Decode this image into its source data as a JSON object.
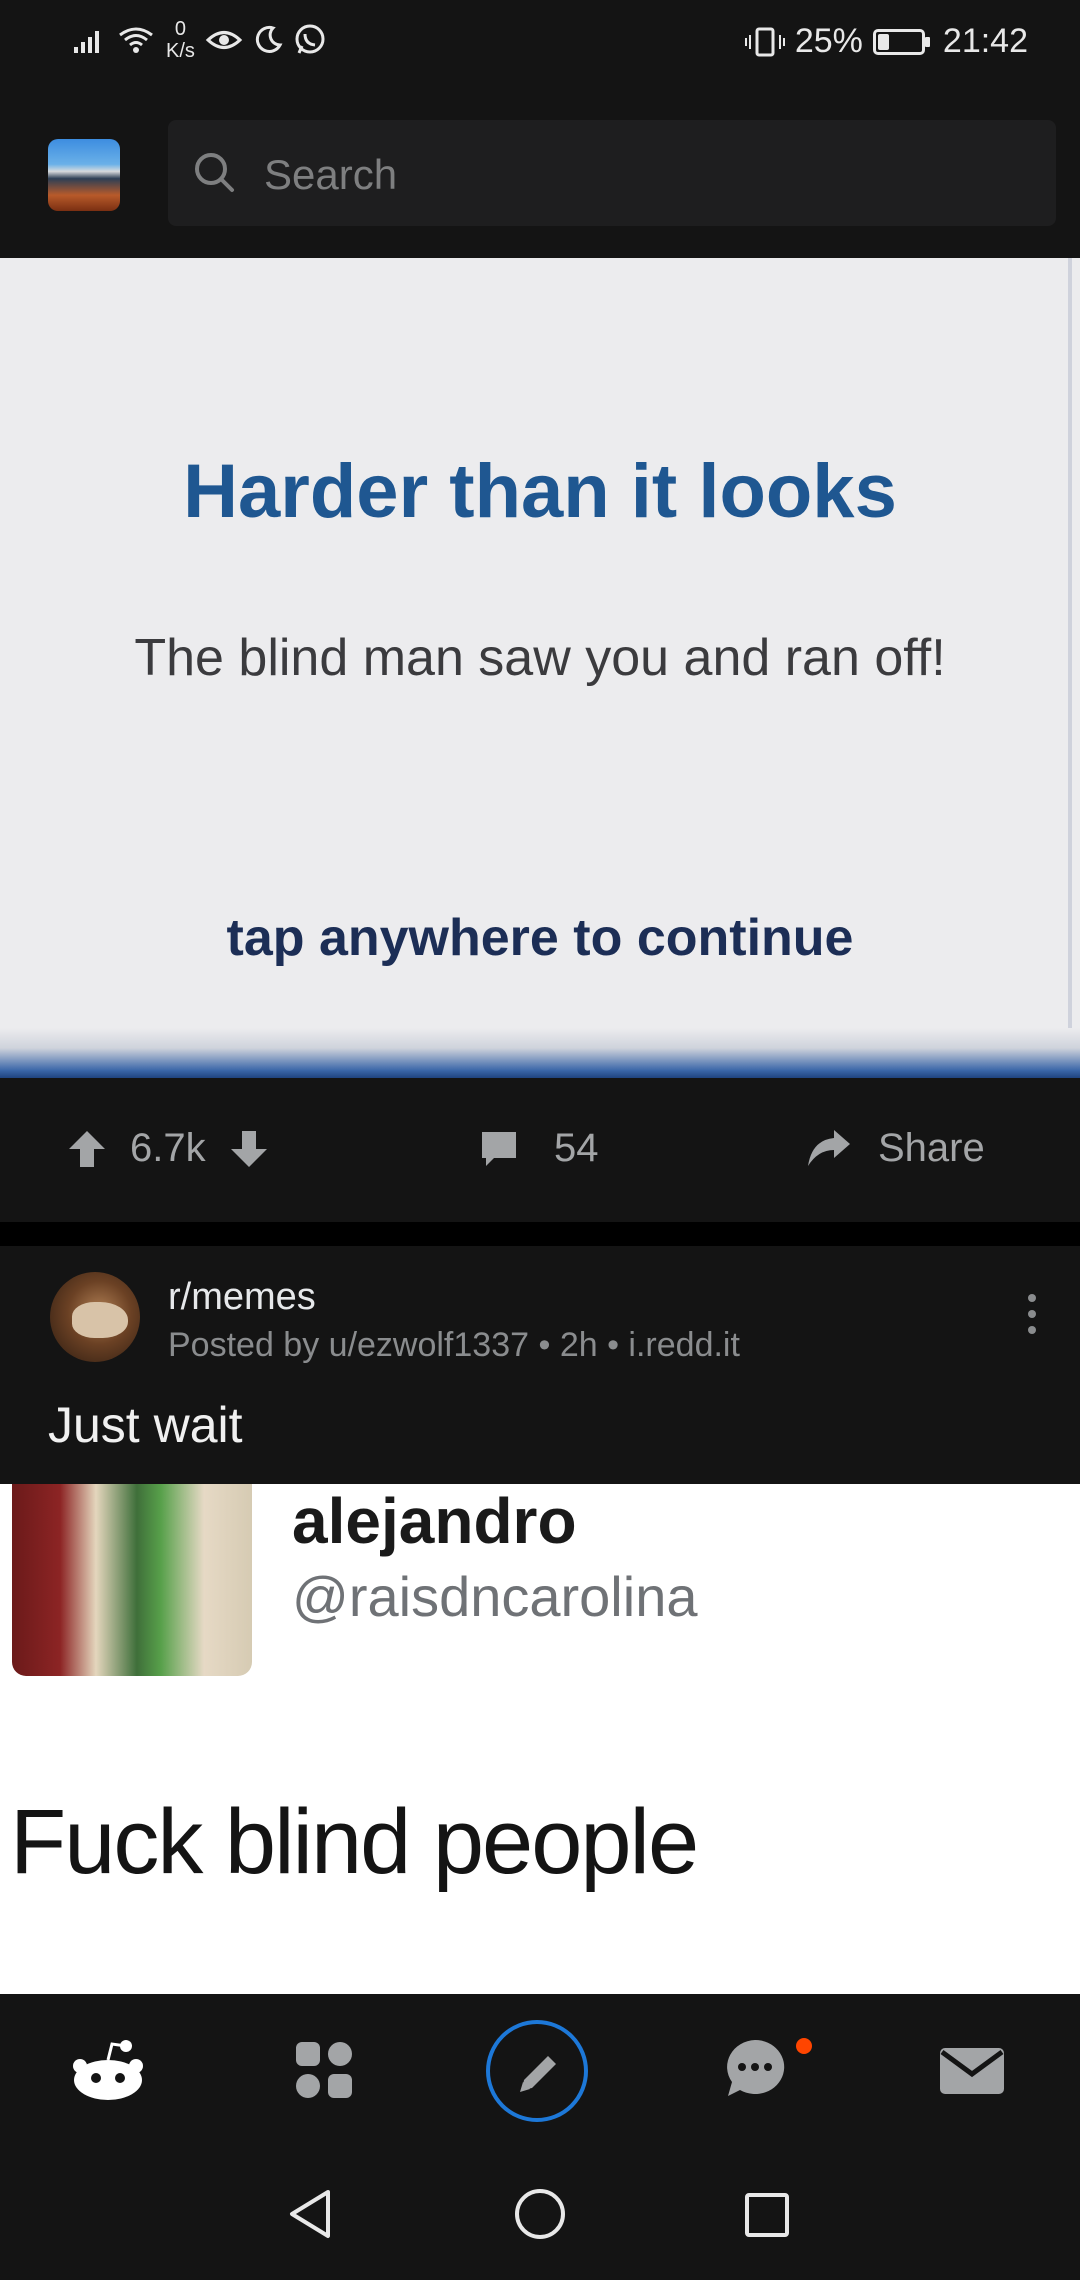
{
  "status_bar": {
    "net_speed_value": "0",
    "net_speed_unit": "K/s",
    "battery_percent": "25%",
    "battery_level": 0.25,
    "time": "21:42"
  },
  "header": {
    "search_placeholder": "Search",
    "icons": [
      "app-logo",
      "search-icon"
    ]
  },
  "post1": {
    "image": {
      "title": "Harder than it looks",
      "message": "The blind man saw you and ran off!",
      "cta": "tap anywhere to continue"
    },
    "actions": {
      "votes": "6.7k",
      "comments": "54",
      "share_label": "Share"
    }
  },
  "post2": {
    "subreddit": "r/memes",
    "meta": "Posted by u/ezwolf1337 • 2h • i.redd.it",
    "title": "Just wait",
    "image": {
      "name": "alejandro",
      "handle": "@raisdncarolina",
      "text": "Fuck blind people"
    }
  },
  "bottom_nav": {
    "items": [
      "home-icon",
      "communities-icon",
      "create-post-icon",
      "chat-icon",
      "inbox-icon"
    ],
    "accent_color": "#1d78d8",
    "badge_color": "#ff4500"
  },
  "system_nav": [
    "back-icon",
    "home-circle-icon",
    "recents-icon"
  ]
}
